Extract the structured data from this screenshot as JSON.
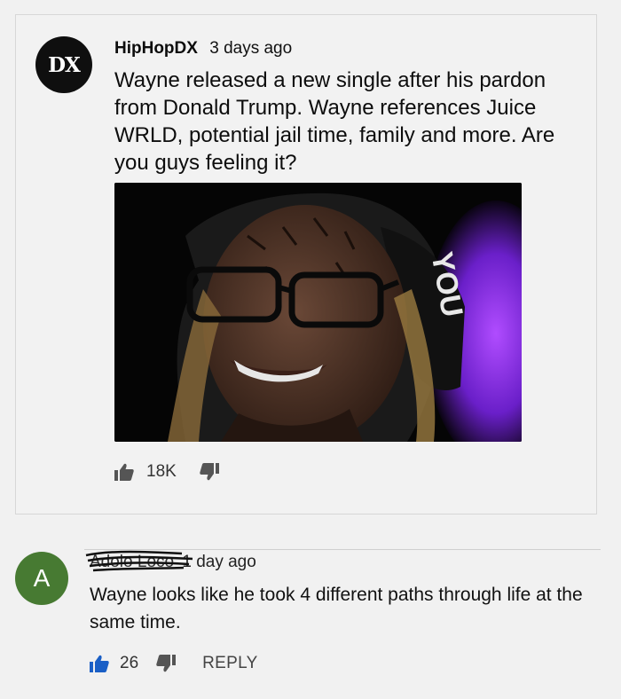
{
  "post": {
    "avatar_text": "DX",
    "author": "HipHopDX",
    "time": "3 days ago",
    "text": "Wayne released a new single after his pardon from Donald Trump. Wayne references Juice WRLD, potential jail time, family and more. Are you guys feeling it?",
    "like_count": "18K",
    "image_caption_text": "YOU",
    "icons": {
      "like": "thumbs-up-icon",
      "dislike": "thumbs-down-icon"
    }
  },
  "comment": {
    "avatar_letter": "A",
    "author": "Adolo Loco",
    "time": "1 day ago",
    "text": "Wayne looks like he took 4 different paths through life at the same time.",
    "like_count": "26",
    "reply_label": "REPLY",
    "like_color": "#1a5fc6"
  },
  "colors": {
    "background": "#f1f1f1",
    "comment_avatar": "#477a32"
  }
}
